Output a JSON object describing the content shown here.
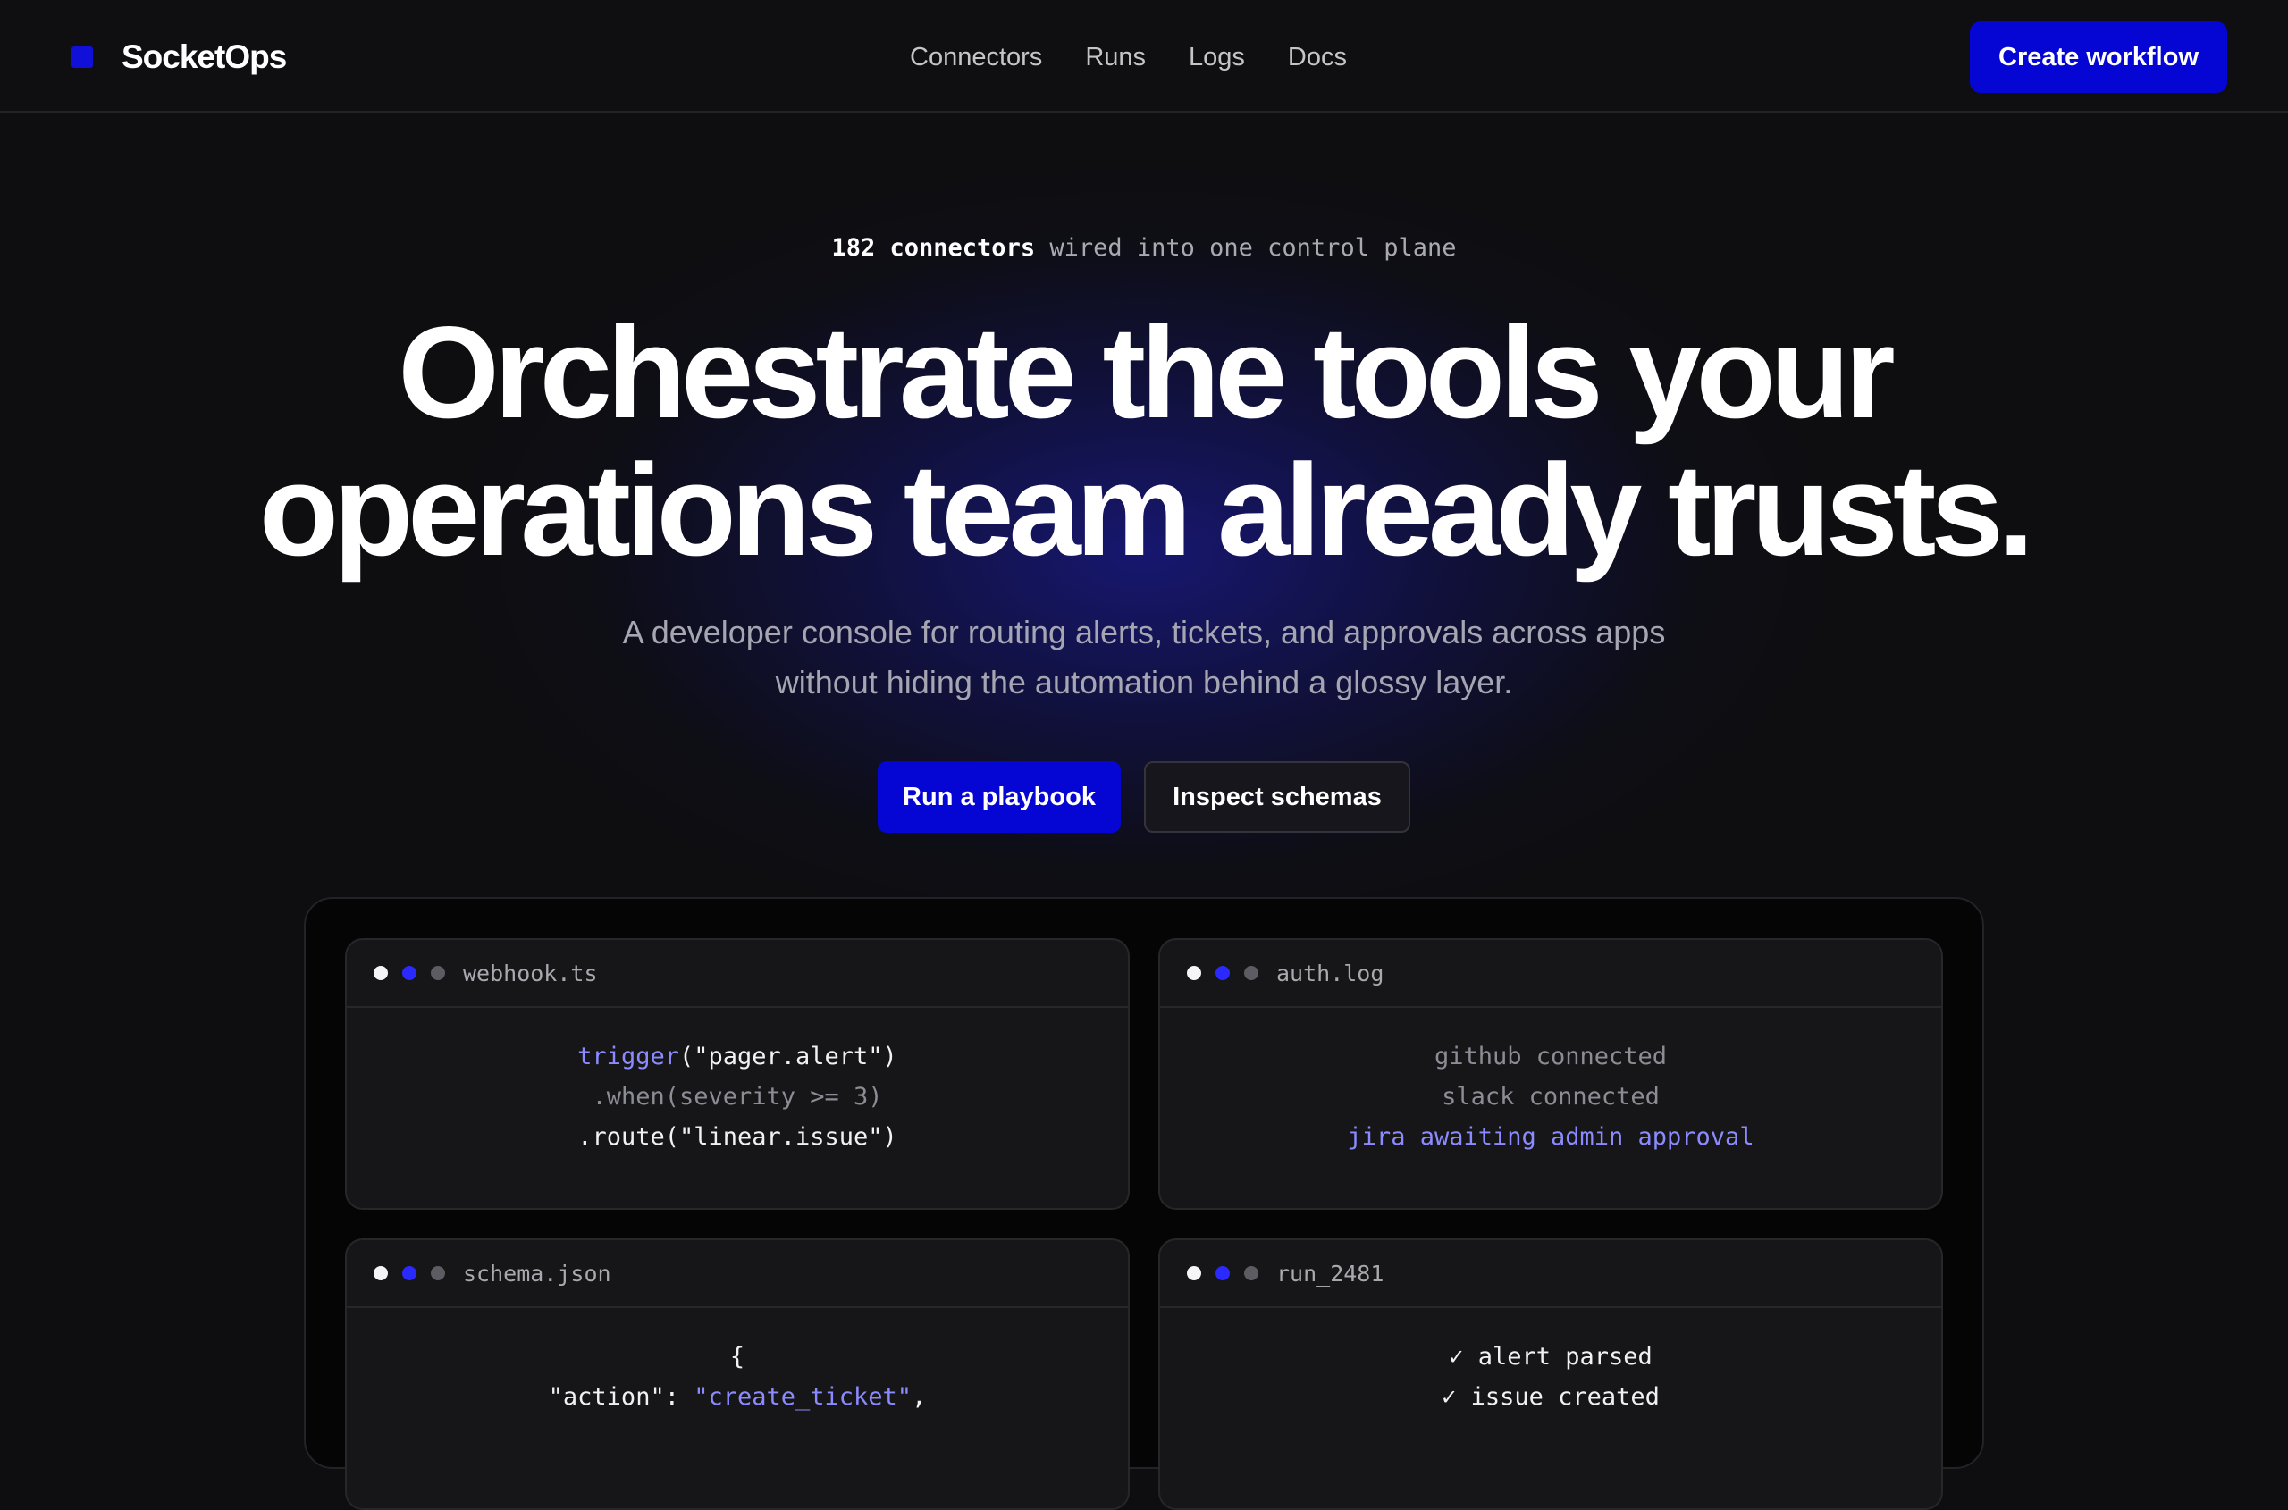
{
  "header": {
    "brand": "SocketOps",
    "nav": [
      "Connectors",
      "Runs",
      "Logs",
      "Docs"
    ],
    "cta": "Create workflow"
  },
  "hero": {
    "tagline_strong": "182 connectors",
    "tagline_rest": " wired into one control plane",
    "headline_line1": "Orchestrate the tools your",
    "headline_line2": "operations team already trusts.",
    "subhead_line1": "A developer console for routing alerts, tickets, and approvals across apps",
    "subhead_line2": "without hiding the automation behind a glossy layer.",
    "primary_button": "Run a playbook",
    "secondary_button": "Inspect schemas"
  },
  "panels": {
    "webhook": {
      "file": "webhook.ts",
      "l1_fn": "trigger",
      "l1_rest": "(\"pager.alert\")",
      "l2": ".when(severity >= 3)",
      "l3": ".route(\"linear.issue\")"
    },
    "auth": {
      "file": "auth.log",
      "l1": "github connected",
      "l2": "slack connected",
      "l3": "jira awaiting admin approval"
    },
    "schema": {
      "file": "schema.json",
      "l1": "{",
      "l2_key": "\"action\": ",
      "l2_val": "\"create_ticket\"",
      "l2_end": ","
    },
    "run": {
      "file": "run_2481",
      "l1": "✓ alert parsed",
      "l2": "✓ issue created"
    }
  },
  "colors": {
    "accent": "#0606d4",
    "code_accent": "#8b8bff",
    "background": "#0e0e10"
  }
}
